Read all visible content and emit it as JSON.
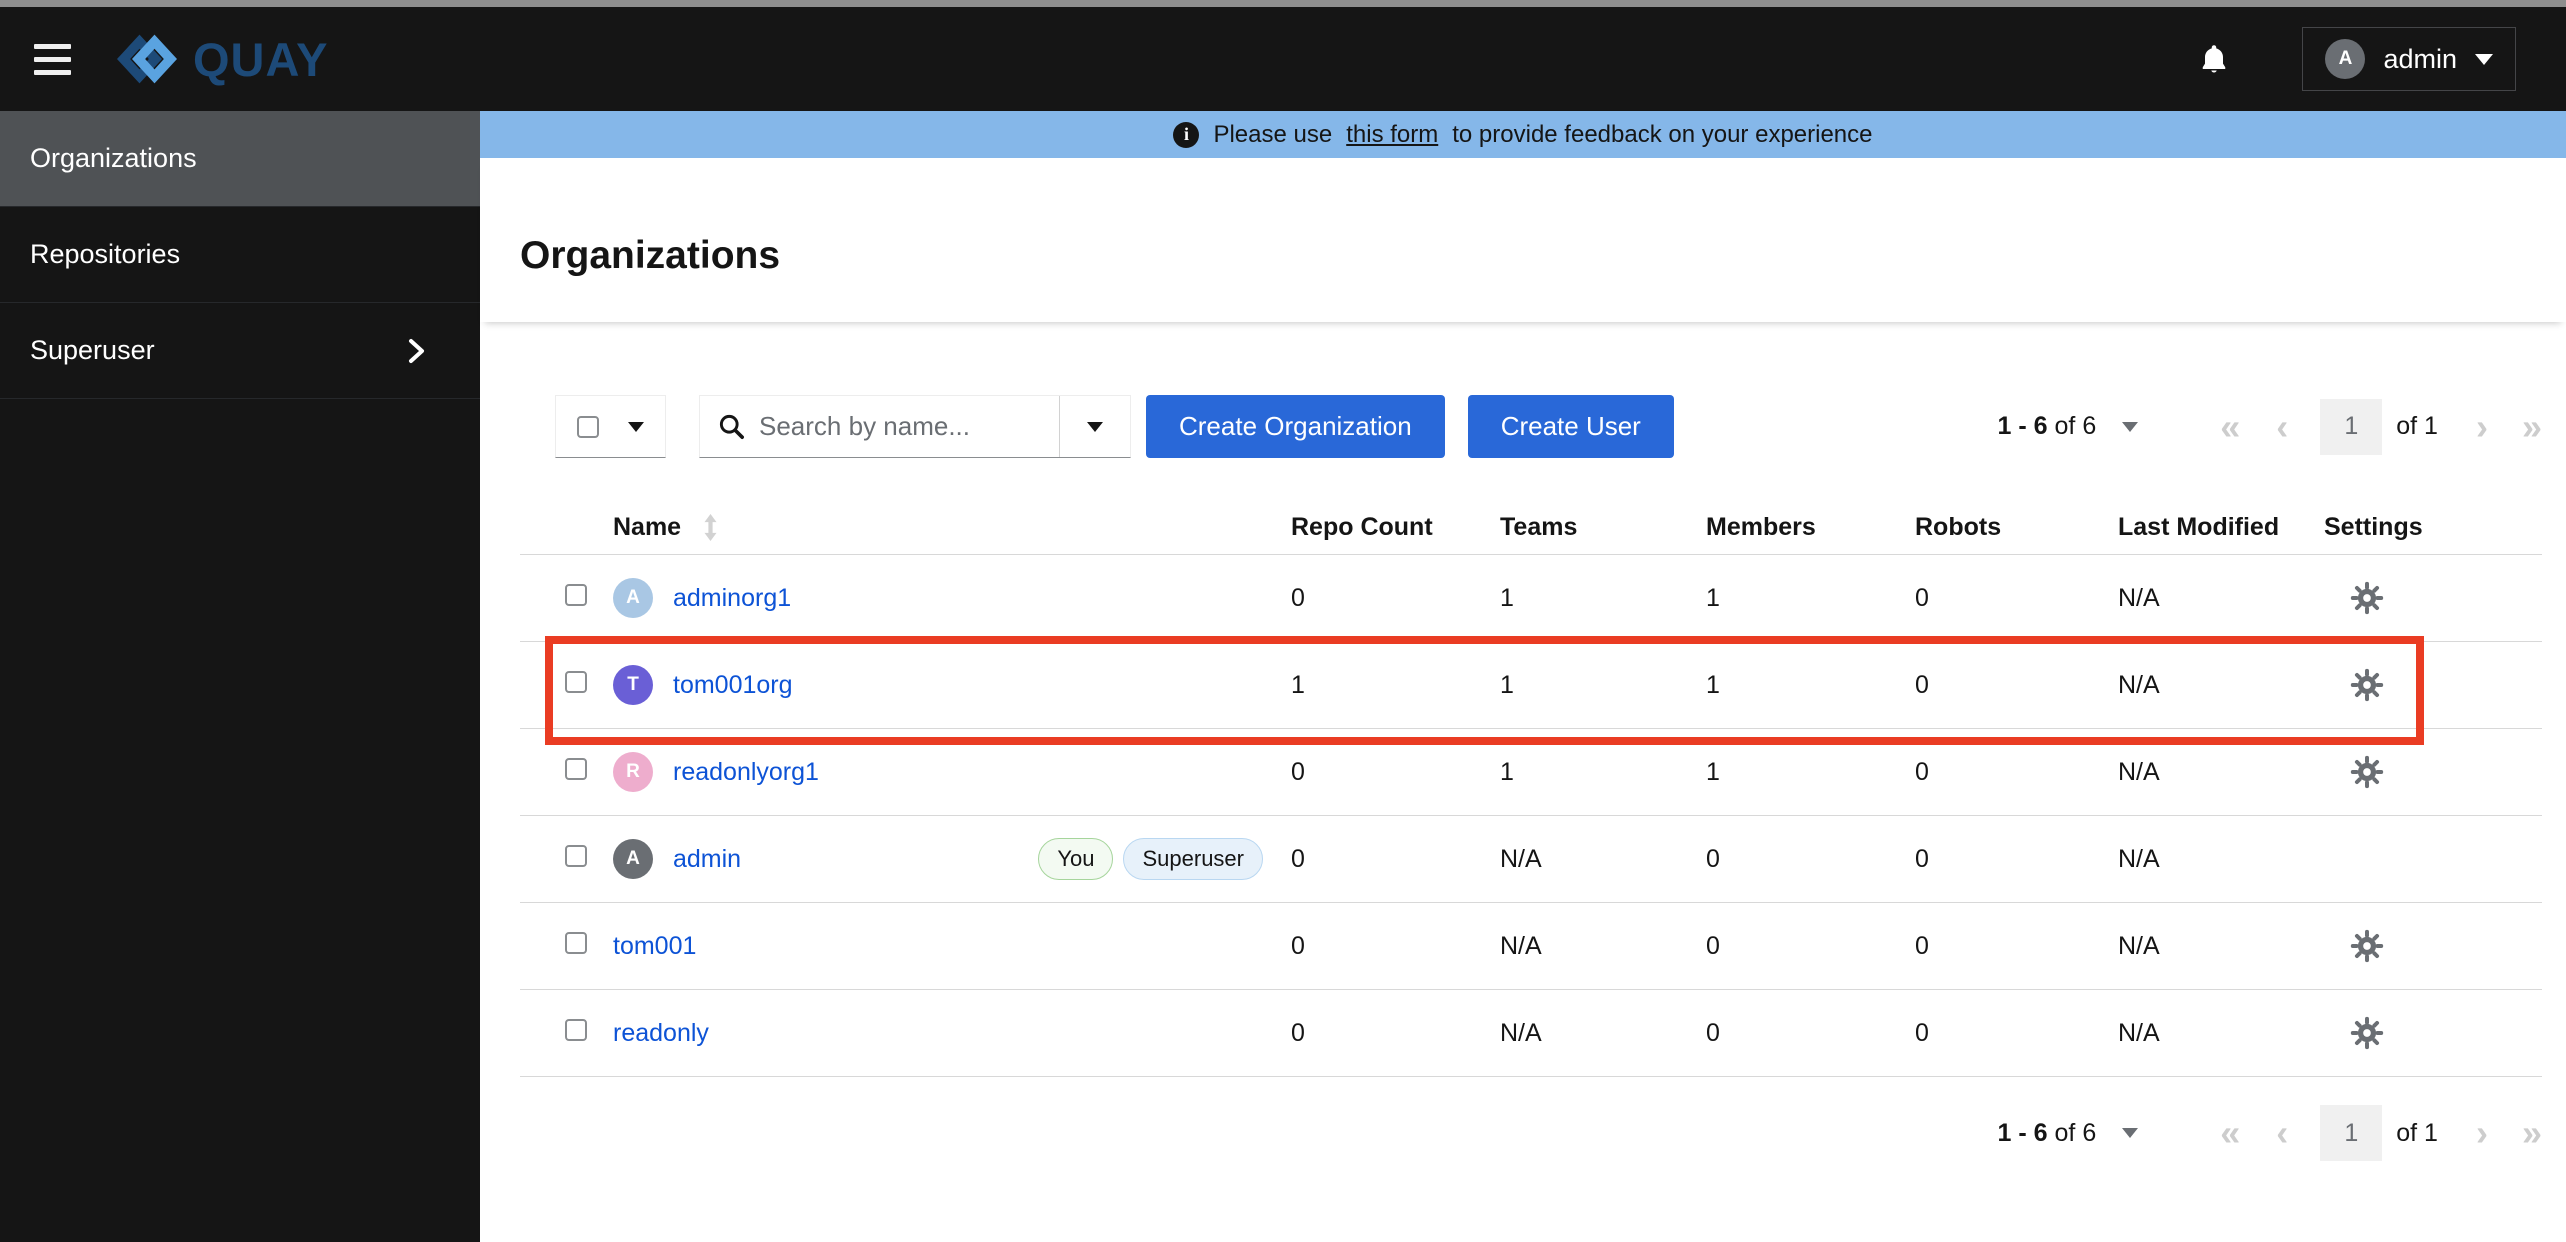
{
  "header": {
    "brand": "QUAY",
    "user": {
      "name": "admin",
      "initial": "A"
    }
  },
  "sidebar": {
    "items": [
      {
        "label": "Organizations",
        "active": true
      },
      {
        "label": "Repositories",
        "active": false
      },
      {
        "label": "Superuser",
        "active": false,
        "expandable": true
      }
    ]
  },
  "banner": {
    "prefix": "Please use",
    "link_text": "this form",
    "suffix": "to provide feedback on your experience"
  },
  "page": {
    "title": "Organizations"
  },
  "toolbar": {
    "search_placeholder": "Search by name...",
    "create_organization_label": "Create Organization",
    "create_user_label": "Create User"
  },
  "pagination": {
    "range": "1 - 6",
    "range_suffix": "of 6",
    "current_page": "1",
    "total": "of 1",
    "first_icon": "«",
    "prev_icon": "‹",
    "next_icon": "›",
    "last_icon": "»"
  },
  "table": {
    "columns": [
      "Name",
      "Repo Count",
      "Teams",
      "Members",
      "Robots",
      "Last Modified",
      "Settings"
    ],
    "rows": [
      {
        "name": "adminorg1",
        "initial": "A",
        "avatar_color": "#a9c7e4",
        "repo_count": "0",
        "teams": "1",
        "members": "1",
        "robots": "0",
        "last_modified": "N/A",
        "has_settings": true,
        "highlighted": false
      },
      {
        "name": "tom001org",
        "initial": "T",
        "avatar_color": "#6a5fd6",
        "repo_count": "1",
        "teams": "1",
        "members": "1",
        "robots": "0",
        "last_modified": "N/A",
        "has_settings": true,
        "highlighted": true
      },
      {
        "name": "readonlyorg1",
        "initial": "R",
        "avatar_color": "#eeadcd",
        "repo_count": "0",
        "teams": "1",
        "members": "1",
        "robots": "0",
        "last_modified": "N/A",
        "has_settings": true,
        "highlighted": false
      },
      {
        "name": "admin",
        "initial": "A",
        "avatar_color": "#6a6e73",
        "repo_count": "0",
        "teams": "N/A",
        "members": "0",
        "robots": "0",
        "last_modified": "N/A",
        "has_settings": false,
        "highlighted": false,
        "badges": [
          {
            "label": "You",
            "bg": "#f3faf2",
            "border": "#a6d59c"
          },
          {
            "label": "Superuser",
            "bg": "#e7f1fa",
            "border": "#b9d7f1"
          }
        ]
      },
      {
        "name": "tom001",
        "repo_count": "0",
        "teams": "N/A",
        "members": "0",
        "robots": "0",
        "last_modified": "N/A",
        "has_settings": true,
        "highlighted": false
      },
      {
        "name": "readonly",
        "repo_count": "0",
        "teams": "N/A",
        "members": "0",
        "robots": "0",
        "last_modified": "N/A",
        "has_settings": true,
        "highlighted": false
      }
    ]
  },
  "colors": {
    "primary_button": "#2968d8",
    "link": "#0d53d6",
    "banner_bg": "#85b7e9",
    "highlight_box": "#ea3c23",
    "masthead_bg": "#151515",
    "nav_selected_bg": "#4f5255",
    "logo_dark": "#1d4a78",
    "logo_light": "#5aa3e0"
  }
}
